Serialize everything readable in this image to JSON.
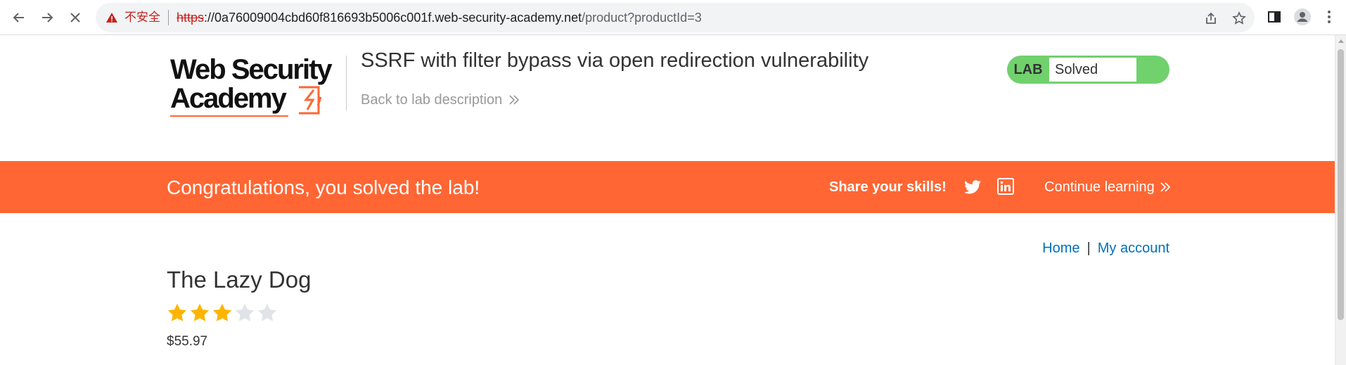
{
  "browser": {
    "security_label": "不安全",
    "url_scheme": "https",
    "url_host": "://0a76009004cbd60f816693b5006c001f.web-security-academy.net",
    "url_path": "/product?productId=3",
    "icons": [
      "back-icon",
      "forward-icon",
      "stop-icon",
      "warning-icon",
      "share-icon",
      "star-icon",
      "side-panel-icon",
      "profile-icon",
      "menu-icon"
    ]
  },
  "header": {
    "logo_line1": "Web Security",
    "logo_line2": "Academy",
    "lab_title": "SSRF with filter bypass via open redirection vulnerability",
    "back_link": "Back to lab description",
    "lab_label": "LAB",
    "lab_status": "Solved",
    "status_color": "#70d16d"
  },
  "banner": {
    "message": "Congratulations, you solved the lab!",
    "share": "Share your skills!",
    "continue": "Continue learning",
    "color": "#ff6633"
  },
  "nav": {
    "home": "Home",
    "separator": "|",
    "account": "My account"
  },
  "product": {
    "name": "The Lazy Dog",
    "rating": 3,
    "rating_max": 5,
    "price": "$55.97"
  }
}
